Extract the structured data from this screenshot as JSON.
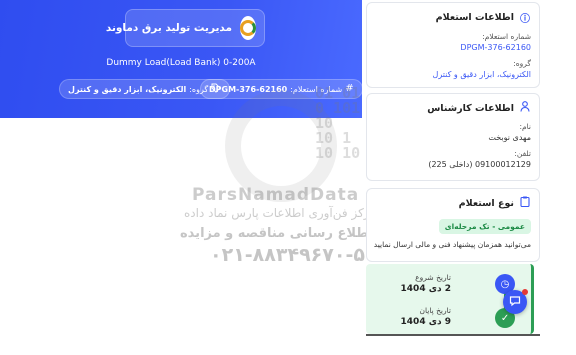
{
  "hero": {
    "org_name": "مدیریت تولید برق دماوند",
    "title": "Dummy Load(Load Bank) 0-200A",
    "number_label": "شماره استعلام:",
    "number_value": "DPGM-376-62160",
    "group_label": "گروه:",
    "group_value": "الکترونیک، ابزار دقیق و کنترل",
    "hash_icon": "hash-icon",
    "tag_icon": "tag-icon"
  },
  "watermark": {
    "bits": [
      "01 01",
      "0 101",
      "10",
      "10 1",
      "10 10"
    ],
    "brand": "ParsNamadData",
    "line1": "مرکز فن‌آوری اطلاعات پارس نماد داده",
    "line2": "پایگاه اطلاع رسانی مناقصه و مزایده",
    "phone": "۰۲۱-۸۸۳۴۹۶۷۰-۵"
  },
  "inquiry_info": {
    "heading": "اطلاعات استعلام",
    "icon": "info-icon",
    "number_label": "شماره استعلام:",
    "number_value": "DPGM-376-62160",
    "group_label": "گروه:",
    "group_value": "الکترونیک، ابزار دقیق و کنترل"
  },
  "expert_info": {
    "heading": "اطلاعات کارشناس",
    "icon": "user-icon",
    "name_label": "نام:",
    "name_value": "مهدی نوبخت",
    "phone_label": "تلفن:",
    "phone_value": "09100012129 (داخلی 225)"
  },
  "inquiry_type": {
    "heading": "نوع استعلام",
    "icon": "clipboard-icon",
    "tag": "عمومی - تک مرحله‌ای",
    "desc": "می‌توانید همزمان پیشنهاد فنی و مالی ارسال نمایید"
  },
  "dates": {
    "start_label": "تاریخ شروع",
    "start_value": "2 دی 1404",
    "end_label": "تاریخ پایان",
    "end_value": "9 دی 1404",
    "start_icon": "clock-icon",
    "end_icon": "check-icon"
  },
  "chat": {
    "icon": "chat-icon"
  },
  "colors": {
    "accent": "#3a57f5",
    "success": "#2c9e55",
    "tag_bg": "#d9f6e4"
  }
}
